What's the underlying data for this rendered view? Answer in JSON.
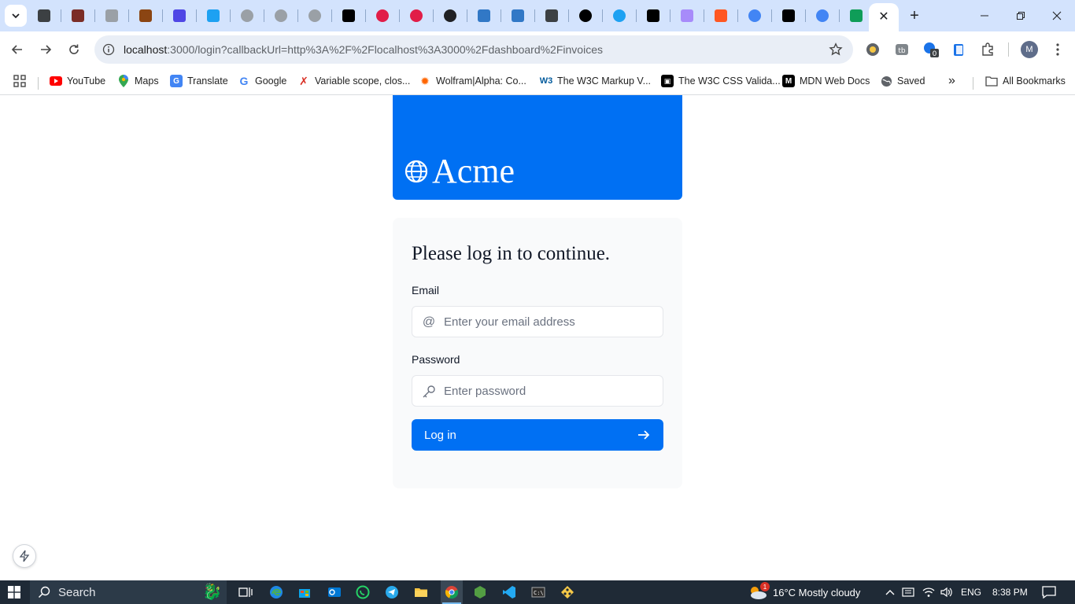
{
  "browser": {
    "tabs": [
      {
        "icon": "cube-icon",
        "color": "#3c4043"
      },
      {
        "icon": "maze-icon",
        "color": "#7b2d26"
      },
      {
        "icon": "github-icon",
        "color": "#9aa0a6"
      },
      {
        "icon": "castle-icon",
        "color": "#8b4513"
      },
      {
        "icon": "x-tool-icon",
        "color": "#4f46e5"
      },
      {
        "icon": "vercel-y-icon",
        "color": "#1da1f2"
      },
      {
        "icon": "globe-icon",
        "color": "#9aa0a6"
      },
      {
        "icon": "globe-icon",
        "color": "#9aa0a6"
      },
      {
        "icon": "globe-icon",
        "color": "#9aa0a6"
      },
      {
        "icon": "hashnode-icon",
        "color": "#000000"
      },
      {
        "icon": "color-wheel-icon",
        "color": "#e11d48"
      },
      {
        "icon": "color-wheel-icon",
        "color": "#e11d48"
      },
      {
        "icon": "react-icon",
        "color": "#202124"
      },
      {
        "icon": "typescript-icon",
        "color": "#3178c6"
      },
      {
        "icon": "typescript-icon",
        "color": "#3178c6"
      },
      {
        "icon": "doc-icon",
        "color": "#3c4043"
      },
      {
        "icon": "upwork-icon",
        "color": "#000000"
      },
      {
        "icon": "circle-icon",
        "color": "#1da1f2"
      },
      {
        "icon": "triangle-icon",
        "color": "#000000"
      },
      {
        "icon": "mail-icon",
        "color": "#a78bfa"
      },
      {
        "icon": "flame-icon",
        "color": "#ff5722"
      },
      {
        "icon": "google-icon",
        "color": "#4285f4"
      },
      {
        "icon": "triangle-icon",
        "color": "#000000"
      },
      {
        "icon": "google-icon",
        "color": "#4285f4"
      },
      {
        "icon": "drive-icon",
        "color": "#0f9d58"
      }
    ],
    "active_tab_close": "✕",
    "new_tab": "+",
    "url_host": "localhost",
    "url_rest": ":3000/login?callbackUrl=http%3A%2F%2Flocalhost%3A3000%2Fdashboard%2Finvoices",
    "profile_initial": "M",
    "extension_badge": "0"
  },
  "bookmarks": {
    "items": [
      {
        "label": "YouTube",
        "icon": "youtube-icon"
      },
      {
        "label": "Maps",
        "icon": "maps-icon"
      },
      {
        "label": "Translate",
        "icon": "translate-icon"
      },
      {
        "label": "Google",
        "icon": "google-icon"
      },
      {
        "label": "Variable scope, clos...",
        "icon": "figure-icon"
      },
      {
        "label": "Wolfram|Alpha: Co...",
        "icon": "wolfram-icon"
      },
      {
        "label": "The W3C Markup V...",
        "icon": "w3c-icon"
      },
      {
        "label": "The W3C CSS Valida...",
        "icon": "css-icon"
      },
      {
        "label": "MDN Web Docs",
        "icon": "mdn-icon"
      },
      {
        "label": "Saved",
        "icon": "globe-icon"
      }
    ],
    "overflow": "»",
    "all_bookmarks": "All Bookmarks"
  },
  "page": {
    "brand": "Acme",
    "heading": "Please log in to continue.",
    "email_label": "Email",
    "email_placeholder": "Enter your email address",
    "password_label": "Password",
    "password_placeholder": "Enter password",
    "login_button": "Log in",
    "accent_color": "#0070f3"
  },
  "taskbar": {
    "search_label": "Search",
    "weather_badge": "1",
    "weather": "16°C  Mostly cloudy",
    "language": "ENG",
    "time": "8:38 PM"
  }
}
